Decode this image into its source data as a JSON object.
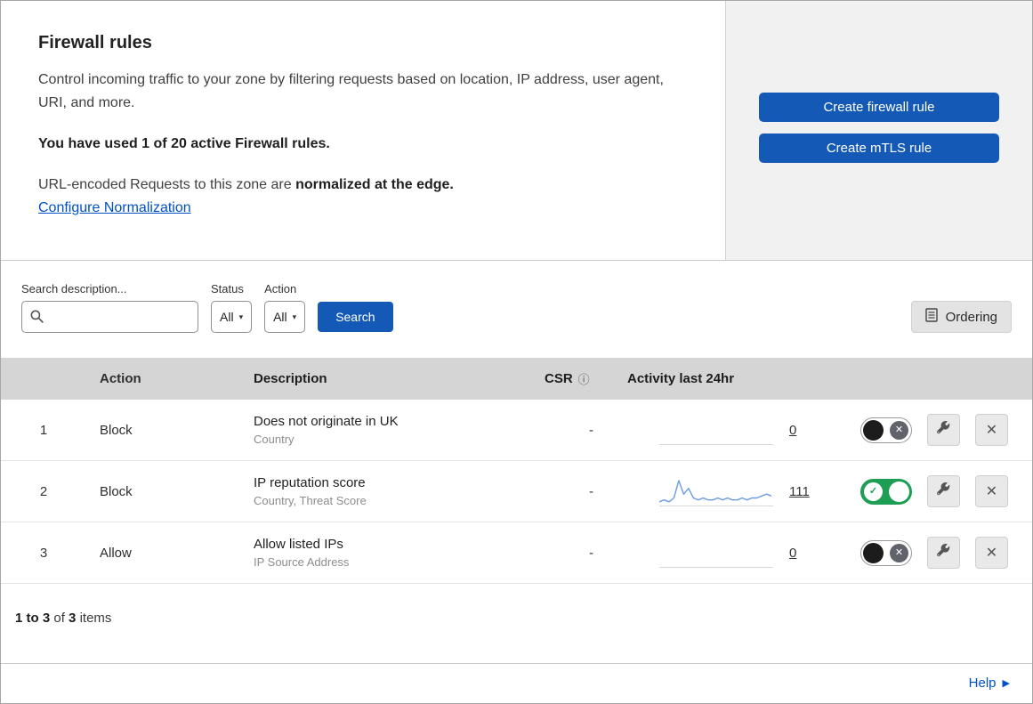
{
  "intro": {
    "title": "Firewall rules",
    "description": "Control incoming traffic to your zone by filtering requests based on location, IP address, user agent, URI, and more.",
    "usage": "You have used 1 of 20 active Firewall rules.",
    "norm_prefix": "URL-encoded Requests to this zone are",
    "norm_bold": "normalized at the edge.",
    "norm_link": "Configure Normalization",
    "create_firewall_label": "Create firewall rule",
    "create_mtls_label": "Create mTLS rule"
  },
  "filters": {
    "search_label": "Search description...",
    "status_label": "Status",
    "status_value": "All",
    "action_label": "Action",
    "action_value": "All",
    "search_button_label": "Search",
    "ordering_label": "Ordering"
  },
  "table": {
    "columns": [
      "Action",
      "Description",
      "CSR",
      "Activity last 24hr"
    ],
    "rows": [
      {
        "index": "1",
        "action": "Block",
        "description": "Does not originate in UK",
        "subtext": "Country",
        "csr": "-",
        "activity": "0",
        "enabled": false
      },
      {
        "index": "2",
        "action": "Block",
        "description": "IP reputation score",
        "subtext": "Country, Threat Score",
        "csr": "-",
        "activity": "111",
        "enabled": true,
        "sparkline": [
          1,
          2,
          1,
          3,
          12,
          5,
          8,
          3,
          2,
          3,
          2,
          2,
          3,
          2,
          3,
          2,
          2,
          3,
          2,
          3,
          3,
          4,
          5,
          4
        ]
      },
      {
        "index": "3",
        "action": "Allow",
        "description": "Allow listed IPs",
        "subtext": "IP Source Address",
        "csr": "-",
        "activity": "0",
        "enabled": false
      }
    ]
  },
  "footer": {
    "range": "1 to 3",
    "of_text": "of",
    "total": "3",
    "items_text": "items",
    "help_label": "Help"
  },
  "icons": {
    "info": "ⓘ",
    "caret": "▾",
    "close": "✕",
    "help_arrow": "▶"
  },
  "colors": {
    "accent_blue": "#1559b7",
    "link_blue": "#0051c3",
    "toggle_green": "#1e9e55",
    "header_gray": "#d5d5d5",
    "panel_gray": "#f1f1f1",
    "sparkline_blue": "#6d9de0"
  }
}
